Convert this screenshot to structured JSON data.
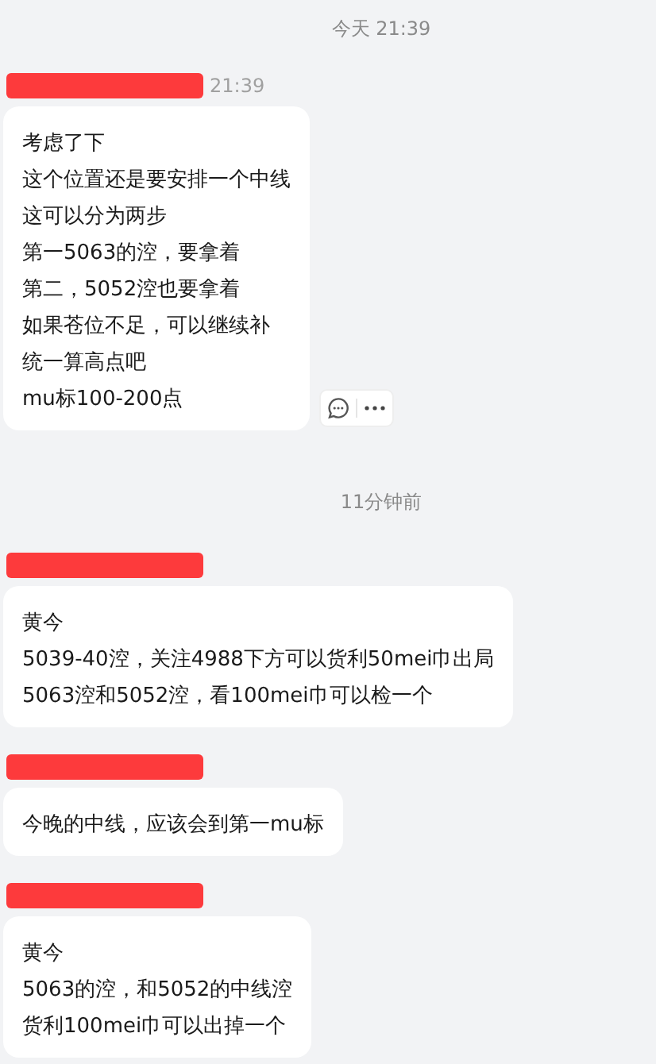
{
  "messages": [
    {
      "kind": "separator",
      "text": "今天 21:39"
    },
    {
      "kind": "message",
      "time": "21:39",
      "actions": true,
      "lines": [
        "考虑了下",
        "这个位置还是要安排一个中线",
        "这可以分为两步",
        "第一5063的涳，要拿着",
        "第二，5052涳也要拿着",
        "如果苍位不足，可以继续补",
        "统一算高点吧",
        "mu标100-200点"
      ]
    },
    {
      "kind": "separator",
      "text": "11分钟前"
    },
    {
      "kind": "message",
      "actions": false,
      "lines": [
        "黄今",
        "5039-40涳，关注4988下方可以货利50mei巾出局",
        "5063涳和5052涳，看100mei巾可以检一个"
      ]
    },
    {
      "kind": "message",
      "actions": false,
      "lines": [
        "今晚的中线，应该会到第一mu标"
      ]
    },
    {
      "kind": "message",
      "actions": false,
      "lines": [
        "黄今",
        "5063的涳，和5052的中线涳",
        "货利100mei巾可以出掉一个"
      ]
    }
  ]
}
